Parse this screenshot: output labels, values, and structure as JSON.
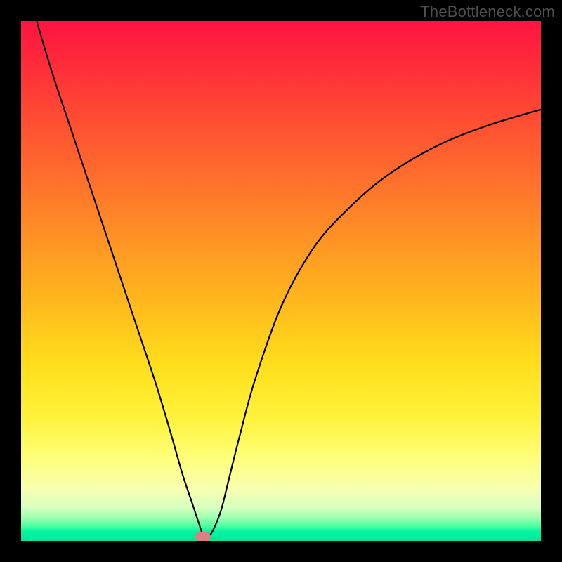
{
  "watermark": "TheBottleneck.com",
  "chart_data": {
    "type": "line",
    "title": "",
    "xlabel": "",
    "ylabel": "",
    "xlim": [
      0,
      100
    ],
    "ylim": [
      0,
      100
    ],
    "legend": false,
    "grid": false,
    "background": "rainbow-gradient-red-to-green",
    "series": [
      {
        "name": "bottleneck-curve",
        "x": [
          3,
          6,
          10,
          14,
          18,
          22,
          26,
          29,
          31,
          33,
          34,
          35,
          36,
          37,
          38.5,
          40,
          42,
          45,
          50,
          56,
          62,
          70,
          80,
          90,
          100
        ],
        "y": [
          100,
          90,
          78,
          66,
          54,
          42,
          30,
          20,
          13,
          7,
          4,
          1.2,
          0.8,
          2.2,
          6,
          12,
          20,
          31,
          45,
          56,
          63,
          70,
          76,
          80,
          83
        ]
      }
    ],
    "marker": {
      "x": 35,
      "y": 0.8,
      "color": "#d98080"
    }
  }
}
